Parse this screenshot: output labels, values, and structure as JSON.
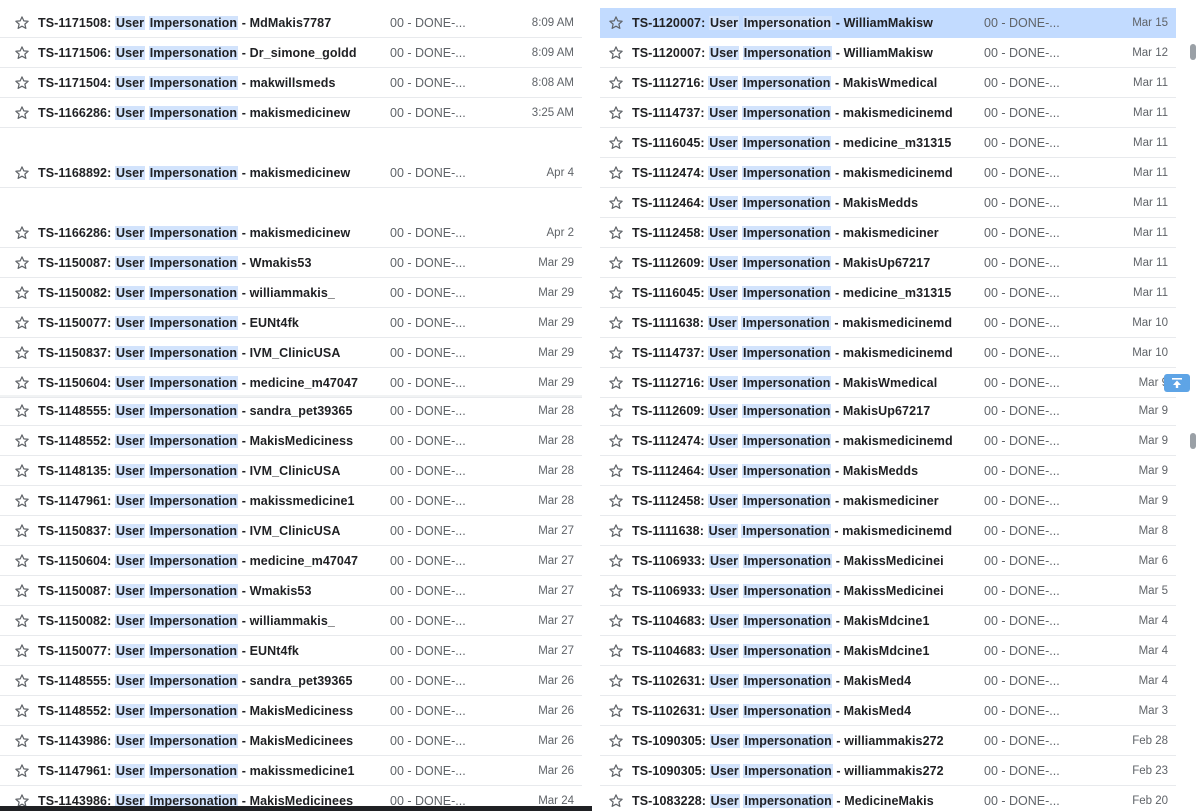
{
  "icons": {
    "star": "star-outline-icon",
    "scroll_top": "arrow-up-to-top-icon"
  },
  "colors": {
    "highlight": "#d2e3fc",
    "selected_row": "#c2dbff",
    "divider": "#e8eaed",
    "to_top_button": "#5ea4e6"
  },
  "left_list": [
    {
      "ticket": "TS-1171508:",
      "k1": "User",
      "k2": "Impersonation",
      "rest": " - MdMakis7787",
      "status": "00 - DONE-...",
      "date": "8:09 AM"
    },
    {
      "ticket": "TS-1171506:",
      "k1": "User",
      "k2": "Impersonation",
      "rest": " - Dr_simone_goldd",
      "status": "00 - DONE-...",
      "date": "8:09 AM"
    },
    {
      "ticket": "TS-1171504:",
      "k1": "User",
      "k2": "Impersonation",
      "rest": " - makwillsmeds",
      "status": "00 - DONE-...",
      "date": "8:08 AM"
    },
    {
      "ticket": "TS-1166286:",
      "k1": "User",
      "k2": "Impersonation",
      "rest": " - makismedicinew",
      "status": "00 - DONE-...",
      "date": "3:25 AM"
    },
    {
      "ticket": "TS-1168892:",
      "k1": "User",
      "k2": "Impersonation",
      "rest": " - makismedicinew",
      "status": "00 - DONE-...",
      "date": "Apr 4"
    },
    {
      "ticket": "TS-1166286:",
      "k1": "User",
      "k2": "Impersonation",
      "rest": " - makismedicinew",
      "status": "00 - DONE-...",
      "date": "Apr 2"
    },
    {
      "ticket": "TS-1150087:",
      "k1": "User",
      "k2": "Impersonation",
      "rest": " - Wmakis53",
      "status": "00 - DONE-...",
      "date": "Mar 29"
    },
    {
      "ticket": "TS-1150082:",
      "k1": "User",
      "k2": "Impersonation",
      "rest": " - williammakis_",
      "status": "00 - DONE-...",
      "date": "Mar 29"
    },
    {
      "ticket": "TS-1150077:",
      "k1": "User",
      "k2": "Impersonation",
      "rest": " - EUNt4fk",
      "status": "00 - DONE-...",
      "date": "Mar 29"
    },
    {
      "ticket": "TS-1150837:",
      "k1": "User",
      "k2": "Impersonation",
      "rest": " - IVM_ClinicUSA",
      "status": "00 - DONE-...",
      "date": "Mar 29"
    },
    {
      "ticket": "TS-1150604:",
      "k1": "User",
      "k2": "Impersonation",
      "rest": " - medicine_m47047",
      "status": "00 - DONE-...",
      "date": "Mar 29"
    },
    {
      "ticket": "TS-1148555:",
      "k1": "User",
      "k2": "Impersonation",
      "rest": " - sandra_pet39365",
      "status": "00 - DONE-...",
      "date": "Mar 28"
    },
    {
      "ticket": "TS-1148552:",
      "k1": "User",
      "k2": "Impersonation",
      "rest": " - MakisMediciness",
      "status": "00 - DONE-...",
      "date": "Mar 28"
    },
    {
      "ticket": "TS-1148135:",
      "k1": "User",
      "k2": "Impersonation",
      "rest": " - IVM_ClinicUSA",
      "status": "00 - DONE-...",
      "date": "Mar 28"
    },
    {
      "ticket": "TS-1147961:",
      "k1": "User",
      "k2": "Impersonation",
      "rest": " - makissmedicine1",
      "status": "00 - DONE-...",
      "date": "Mar 28"
    },
    {
      "ticket": "TS-1150837:",
      "k1": "User",
      "k2": "Impersonation",
      "rest": " - IVM_ClinicUSA",
      "status": "00 - DONE-...",
      "date": "Mar 27"
    },
    {
      "ticket": "TS-1150604:",
      "k1": "User",
      "k2": "Impersonation",
      "rest": " - medicine_m47047",
      "status": "00 - DONE-...",
      "date": "Mar 27"
    },
    {
      "ticket": "TS-1150087:",
      "k1": "User",
      "k2": "Impersonation",
      "rest": " - Wmakis53",
      "status": "00 - DONE-...",
      "date": "Mar 27"
    },
    {
      "ticket": "TS-1150082:",
      "k1": "User",
      "k2": "Impersonation",
      "rest": " - williammakis_",
      "status": "00 - DONE-...",
      "date": "Mar 27"
    },
    {
      "ticket": "TS-1150077:",
      "k1": "User",
      "k2": "Impersonation",
      "rest": " - EUNt4fk",
      "status": "00 - DONE-...",
      "date": "Mar 27"
    },
    {
      "ticket": "TS-1148555:",
      "k1": "User",
      "k2": "Impersonation",
      "rest": " - sandra_pet39365",
      "status": "00 - DONE-...",
      "date": "Mar 26"
    },
    {
      "ticket": "TS-1148552:",
      "k1": "User",
      "k2": "Impersonation",
      "rest": " - MakisMediciness",
      "status": "00 - DONE-...",
      "date": "Mar 26"
    },
    {
      "ticket": "TS-1143986:",
      "k1": "User",
      "k2": "Impersonation",
      "rest": " - MakisMedicinees",
      "status": "00 - DONE-...",
      "date": "Mar 26"
    },
    {
      "ticket": "TS-1147961:",
      "k1": "User",
      "k2": "Impersonation",
      "rest": " - makissmedicine1",
      "status": "00 - DONE-...",
      "date": "Mar 26"
    },
    {
      "ticket": "TS-1143986:",
      "k1": "User",
      "k2": "Impersonation",
      "rest": " - MakisMedicinees",
      "status": "00 - DONE-...",
      "date": "Mar 24"
    }
  ],
  "right_list": [
    {
      "ticket": "TS-1120007:",
      "k1": "User",
      "k2": "Impersonation",
      "rest": " - WilliamMakisw",
      "status": "00 - DONE-...",
      "date": "Mar 15",
      "selected": true
    },
    {
      "ticket": "TS-1120007:",
      "k1": "User",
      "k2": "Impersonation",
      "rest": " - WilliamMakisw",
      "status": "00 - DONE-...",
      "date": "Mar 12"
    },
    {
      "ticket": "TS-1112716:",
      "k1": "User",
      "k2": "Impersonation",
      "rest": " - MakisWmedical",
      "status": "00 - DONE-...",
      "date": "Mar 11"
    },
    {
      "ticket": "TS-1114737:",
      "k1": "User",
      "k2": "Impersonation",
      "rest": " - makismedicinemd",
      "status": "00 - DONE-...",
      "date": "Mar 11"
    },
    {
      "ticket": "TS-1116045:",
      "k1": "User",
      "k2": "Impersonation",
      "rest": " - medicine_m31315",
      "status": "00 - DONE-...",
      "date": "Mar 11"
    },
    {
      "ticket": "TS-1112474:",
      "k1": "User",
      "k2": "Impersonation",
      "rest": " - makismedicinemd",
      "status": "00 - DONE-...",
      "date": "Mar 11"
    },
    {
      "ticket": "TS-1112464:",
      "k1": "User",
      "k2": "Impersonation",
      "rest": " - MakisMedds",
      "status": "00 - DONE-...",
      "date": "Mar 11"
    },
    {
      "ticket": "TS-1112458:",
      "k1": "User",
      "k2": "Impersonation",
      "rest": " - makismediciner",
      "status": "00 - DONE-...",
      "date": "Mar 11"
    },
    {
      "ticket": "TS-1112609:",
      "k1": "User",
      "k2": "Impersonation",
      "rest": " - MakisUp67217",
      "status": "00 - DONE-...",
      "date": "Mar 11"
    },
    {
      "ticket": "TS-1116045:",
      "k1": "User",
      "k2": "Impersonation",
      "rest": " - medicine_m31315",
      "status": "00 - DONE-...",
      "date": "Mar 11"
    },
    {
      "ticket": "TS-1111638:",
      "k1": "User",
      "k2": "Impersonation",
      "rest": " - makismedicinemd",
      "status": "00 - DONE-...",
      "date": "Mar 10"
    },
    {
      "ticket": "TS-1114737:",
      "k1": "User",
      "k2": "Impersonation",
      "rest": " - makismedicinemd",
      "status": "00 - DONE-...",
      "date": "Mar 10"
    },
    {
      "ticket": "TS-1112716:",
      "k1": "User",
      "k2": "Impersonation",
      "rest": " - MakisWmedical",
      "status": "00 - DONE-...",
      "date": "Mar 9"
    },
    {
      "ticket": "TS-1112609:",
      "k1": "User",
      "k2": "Impersonation",
      "rest": " - MakisUp67217",
      "status": "00 - DONE-...",
      "date": "Mar 9"
    },
    {
      "ticket": "TS-1112474:",
      "k1": "User",
      "k2": "Impersonation",
      "rest": " - makismedicinemd",
      "status": "00 - DONE-...",
      "date": "Mar 9"
    },
    {
      "ticket": "TS-1112464:",
      "k1": "User",
      "k2": "Impersonation",
      "rest": " - MakisMedds",
      "status": "00 - DONE-...",
      "date": "Mar 9"
    },
    {
      "ticket": "TS-1112458:",
      "k1": "User",
      "k2": "Impersonation",
      "rest": " - makismediciner",
      "status": "00 - DONE-...",
      "date": "Mar 9"
    },
    {
      "ticket": "TS-1111638:",
      "k1": "User",
      "k2": "Impersonation",
      "rest": " - makismedicinemd",
      "status": "00 - DONE-...",
      "date": "Mar 8"
    },
    {
      "ticket": "TS-1106933:",
      "k1": "User",
      "k2": "Impersonation",
      "rest": " - MakissMedicinei",
      "status": "00 - DONE-...",
      "date": "Mar 6"
    },
    {
      "ticket": "TS-1106933:",
      "k1": "User",
      "k2": "Impersonation",
      "rest": " - MakissMedicinei",
      "status": "00 - DONE-...",
      "date": "Mar 5"
    },
    {
      "ticket": "TS-1104683:",
      "k1": "User",
      "k2": "Impersonation",
      "rest": " - MakisMdcine1",
      "status": "00 - DONE-...",
      "date": "Mar 4"
    },
    {
      "ticket": "TS-1104683:",
      "k1": "User",
      "k2": "Impersonation",
      "rest": " - MakisMdcine1",
      "status": "00 - DONE-...",
      "date": "Mar 4"
    },
    {
      "ticket": "TS-1102631:",
      "k1": "User",
      "k2": "Impersonation",
      "rest": " - MakisMed4",
      "status": "00 - DONE-...",
      "date": "Mar 4"
    },
    {
      "ticket": "TS-1102631:",
      "k1": "User",
      "k2": "Impersonation",
      "rest": " - MakisMed4",
      "status": "00 - DONE-...",
      "date": "Mar 3"
    },
    {
      "ticket": "TS-1090305:",
      "k1": "User",
      "k2": "Impersonation",
      "rest": " - williammakis272",
      "status": "00 - DONE-...",
      "date": "Feb 28"
    },
    {
      "ticket": "TS-1090305:",
      "k1": "User",
      "k2": "Impersonation",
      "rest": " - williammakis272",
      "status": "00 - DONE-...",
      "date": "Feb 23"
    },
    {
      "ticket": "TS-1083228:",
      "k1": "User",
      "k2": "Impersonation",
      "rest": " - MedicineMakis",
      "status": "00 - DONE-...",
      "date": "Feb 20"
    }
  ]
}
